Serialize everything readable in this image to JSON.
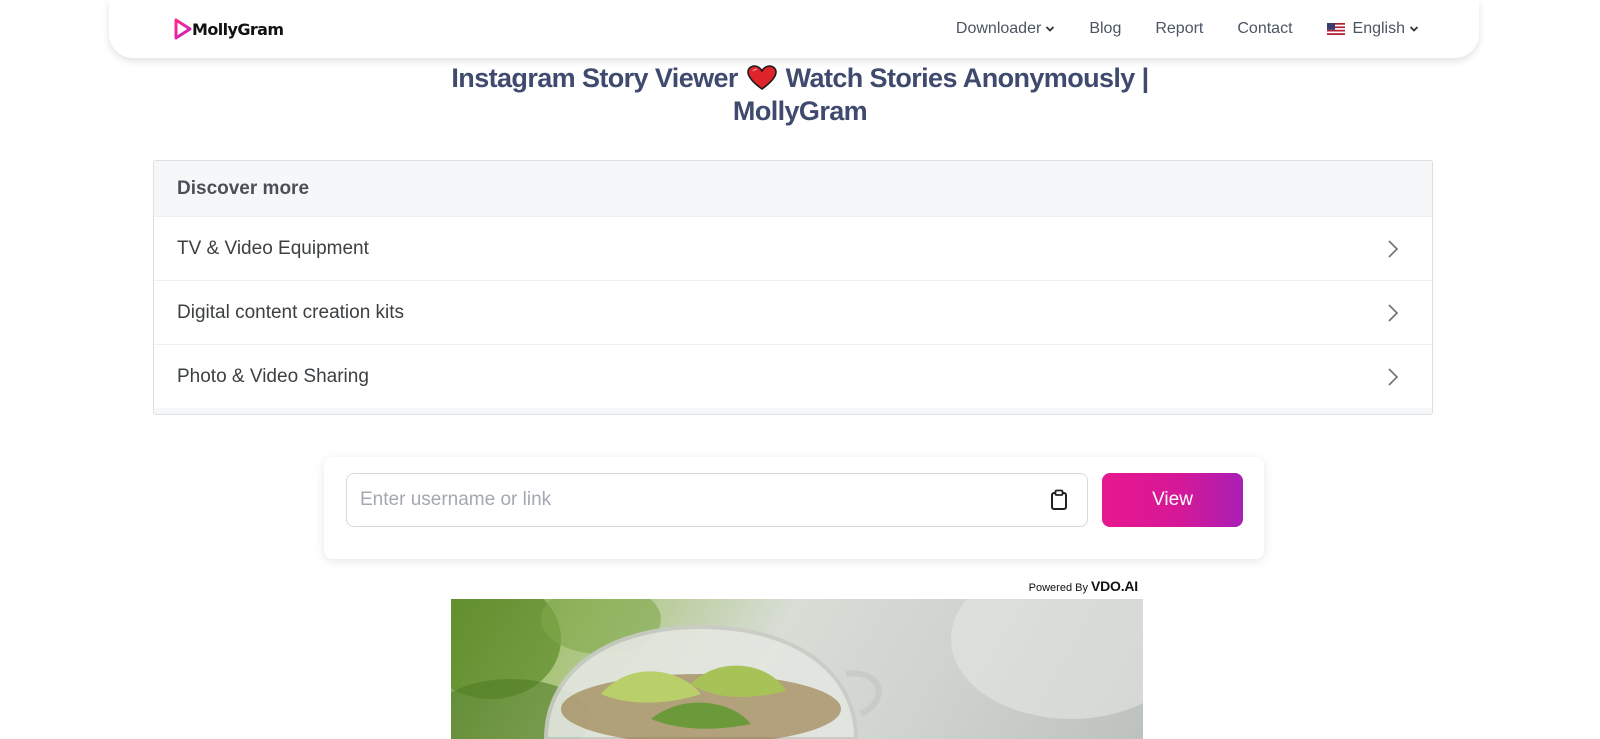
{
  "nav": {
    "brand": "MollyGram",
    "links": {
      "downloader": "Downloader",
      "blog": "Blog",
      "report": "Report",
      "contact": "Contact",
      "language": "English"
    }
  },
  "page": {
    "title_line1": "Instagram Story Viewer",
    "title_line1_rest": "Watch Stories Anonymously |",
    "title_line2": "MollyGram"
  },
  "discover": {
    "header": "Discover more",
    "items": [
      "TV & Video Equipment",
      "Digital content creation kits",
      "Photo & Video Sharing"
    ]
  },
  "search": {
    "placeholder": "Enter username or link",
    "value": "",
    "button_label": "View"
  },
  "ad": {
    "powered_label": "Powered By",
    "powered_brand": "VDO.AI"
  },
  "colors": {
    "brand_pink": "#e8178e",
    "brand_purple": "#a81fb4",
    "title": "#3f4a6e"
  },
  "icons": [
    "play-logo-icon",
    "chevron-down-icon",
    "us-flag-icon",
    "heart-icon",
    "chevron-right-icon",
    "clipboard-icon"
  ]
}
